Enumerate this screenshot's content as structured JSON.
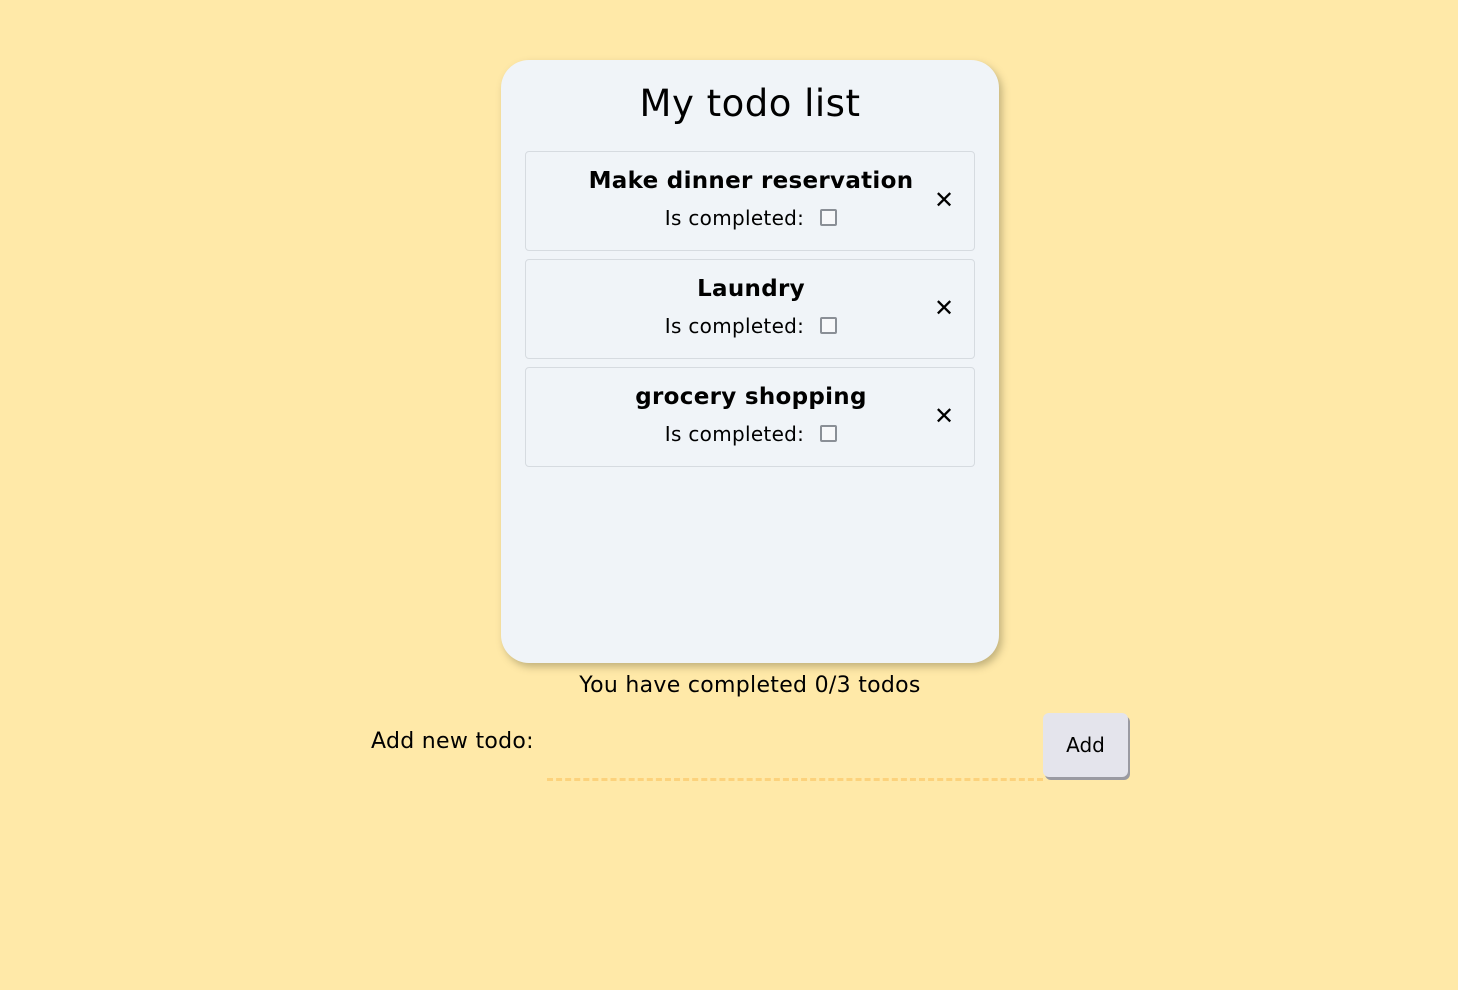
{
  "app": {
    "title": "My todo list"
  },
  "todos": [
    {
      "text": "Make dinner reservation",
      "status_label": "Is completed:",
      "completed": false,
      "delete_icon": "close-icon"
    },
    {
      "text": "Laundry",
      "status_label": "Is completed:",
      "completed": false,
      "delete_icon": "close-icon"
    },
    {
      "text": "grocery shopping",
      "status_label": "Is completed:",
      "completed": false,
      "delete_icon": "close-icon"
    }
  ],
  "summary": {
    "text": "You have completed 0/3 todos"
  },
  "add_form": {
    "label": "Add new todo:",
    "input_value": "",
    "input_placeholder": "",
    "button_label": "Add"
  },
  "colors": {
    "page_background": "#ffe9a8",
    "card_background": "#f0f4f8",
    "input_underline": "#fcd27c",
    "button_background": "#e4e4ec"
  }
}
